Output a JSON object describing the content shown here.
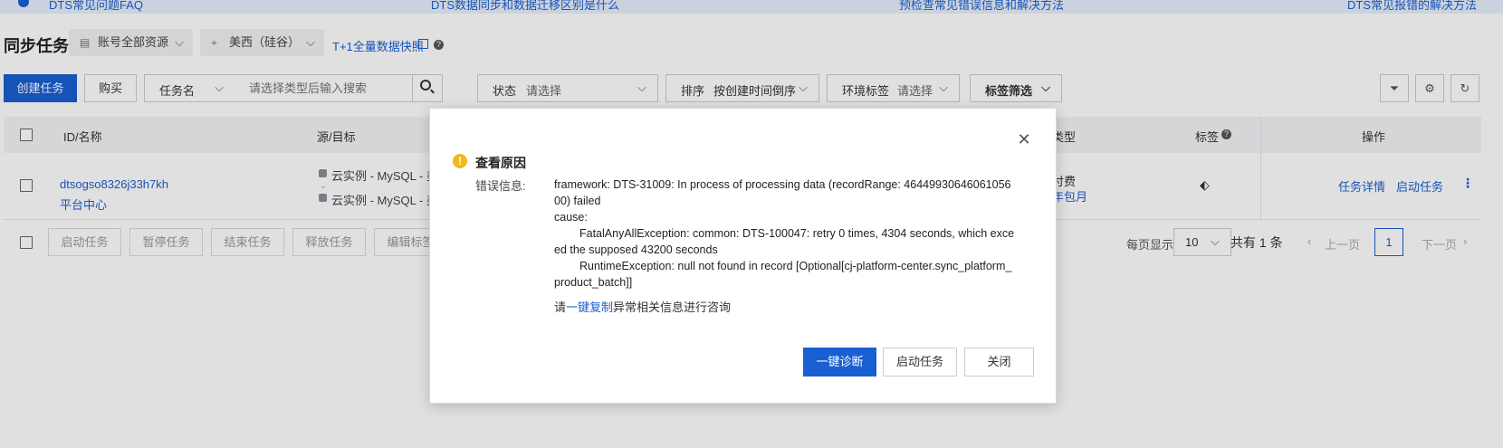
{
  "banner": {
    "items": [
      "DTS常见问题FAQ",
      "DTS数据同步和数据迁移区别是什么",
      "预检查常见错误信息和解决方法",
      "DTS常见报错的解决方法"
    ]
  },
  "header": {
    "title": "同步任务",
    "account_select": "账号全部资源",
    "region_select": "美西（硅谷）",
    "snapshot_link": "T+1全量数据快照"
  },
  "toolbar": {
    "create_label": "创建任务",
    "buy_label": "购买",
    "search_type": "任务名",
    "search_placeholder": "请选择类型后输入搜索",
    "status_label": "状态",
    "status_value": "请选择",
    "sort_label": "排序",
    "sort_value": "按创建时间倒序",
    "env_label": "环境标签",
    "env_value": "请选择",
    "tag_filter_label": "标签筛选"
  },
  "table": {
    "columns": [
      "ID/名称",
      "源/目标",
      "类型",
      "标签",
      "操作"
    ],
    "rows": [
      {
        "id": "dtsogso8326j33h7kh",
        "name": "平台中心",
        "source": "云实例 - MySQL - 美",
        "target": "云实例 - MySQL - 美",
        "billing_line1": "付费",
        "billing_line2": "年包月",
        "action_detail": "任务详情",
        "action_start": "启动任务"
      }
    ]
  },
  "footer": {
    "batch_actions": [
      "启动任务",
      "暂停任务",
      "结束任务",
      "释放任务",
      "编辑标签"
    ],
    "page_size_label": "每页显示",
    "page_size_value": "10",
    "total": "共有 1 条",
    "prev": "上一页",
    "current_page": "1",
    "next": "下一页"
  },
  "modal": {
    "title": "查看原因",
    "error_label": "错误信息:",
    "error_line1": "framework: DTS-31009: In process of processing data (recordRange: 4644993064606105600) failed",
    "error_line2": "cause:",
    "error_line3": "FatalAnyAllException: common: DTS-100047: retry 0 times, 4304 seconds, which exceed the supposed 43200 seconds",
    "error_line4": "RuntimeException: null not found in record [Optional[cj-platform-center.sync_platform_product_batch]]",
    "hint_prefix": "请",
    "hint_link": "一键复制",
    "hint_suffix": "异常相关信息进行咨询",
    "diagnose_label": "一键诊断",
    "start_label": "启动任务",
    "close_label": "关闭"
  },
  "colors": {
    "primary": "#1a5fd2",
    "warning": "#f2b81c"
  }
}
